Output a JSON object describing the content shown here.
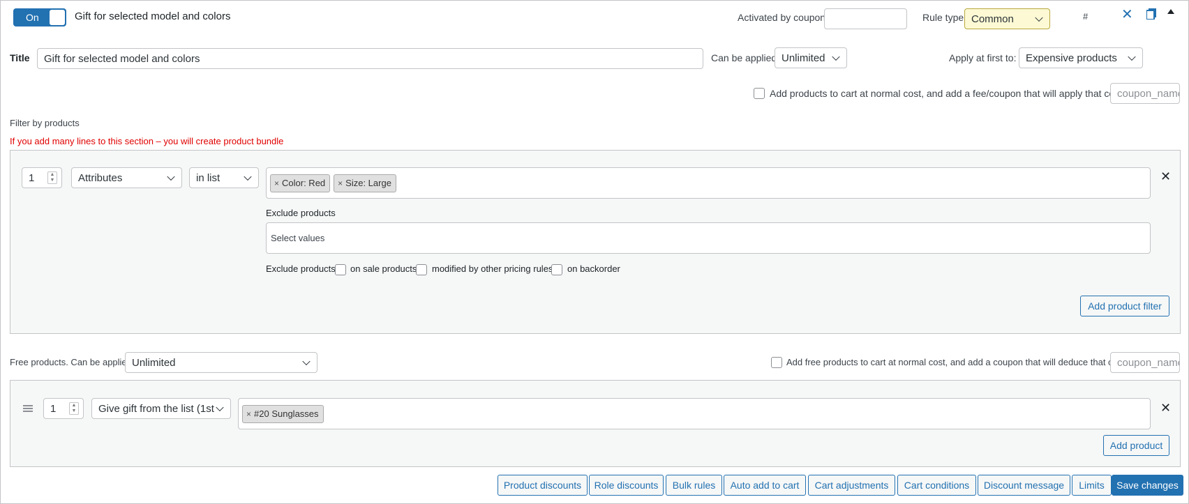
{
  "header": {
    "toggle_label": "On",
    "rule_name": "Gift for selected model and colors",
    "activated_by_coupon_label": "Activated by coupon",
    "activated_by_coupon_value": "",
    "rule_type_label": "Rule type",
    "rule_type_value": "Common",
    "hash": "#"
  },
  "rule": {
    "title_label": "Title",
    "title_value": "Gift for selected model and colors",
    "can_be_applied_label": "Can be applied",
    "can_be_applied_value": "Unlimited",
    "apply_first_label": "Apply at first to:",
    "apply_first_value": "Expensive products",
    "normal_cost_label": "Add products to cart at normal cost, and add a fee/coupon that will apply that cost",
    "coupon_placeholder": "coupon_name"
  },
  "filter": {
    "section_label": "Filter by products",
    "warning": "If you add many lines to this section – you will create product bundle",
    "qty": "1",
    "type": "Attributes",
    "method": "in list",
    "chips": [
      "Color: Red",
      "Size: Large"
    ],
    "exclude_label": "Exclude products",
    "exclude_placeholder": "Select values",
    "exclude_products_label": "Exclude products",
    "on_sale_label": "on sale products",
    "modified_label": "modified by other pricing rules",
    "backorder_label": "on backorder",
    "add_filter_button": "Add product filter"
  },
  "free": {
    "label": "Free products. Can be applied",
    "can_be_applied_value": "Unlimited",
    "normal_cost_label": "Add free products to cart at normal cost, and add a coupon that will deduce that cost",
    "coupon_placeholder": "coupon_name",
    "qty": "1",
    "gift_mode": "Give gift from the list (1st",
    "chips": [
      "#20 Sunglasses"
    ],
    "add_product_button": "Add product"
  },
  "footer": {
    "buttons": [
      "Product discounts",
      "Role discounts",
      "Bulk rules",
      "Auto add to cart",
      "Cart adjustments",
      "Cart conditions",
      "Discount message",
      "Limits"
    ],
    "save": "Save changes"
  },
  "colors": {
    "accent": "#2271b1",
    "warning": "#e00000",
    "rule_type_bg": "#fcf9d4"
  }
}
